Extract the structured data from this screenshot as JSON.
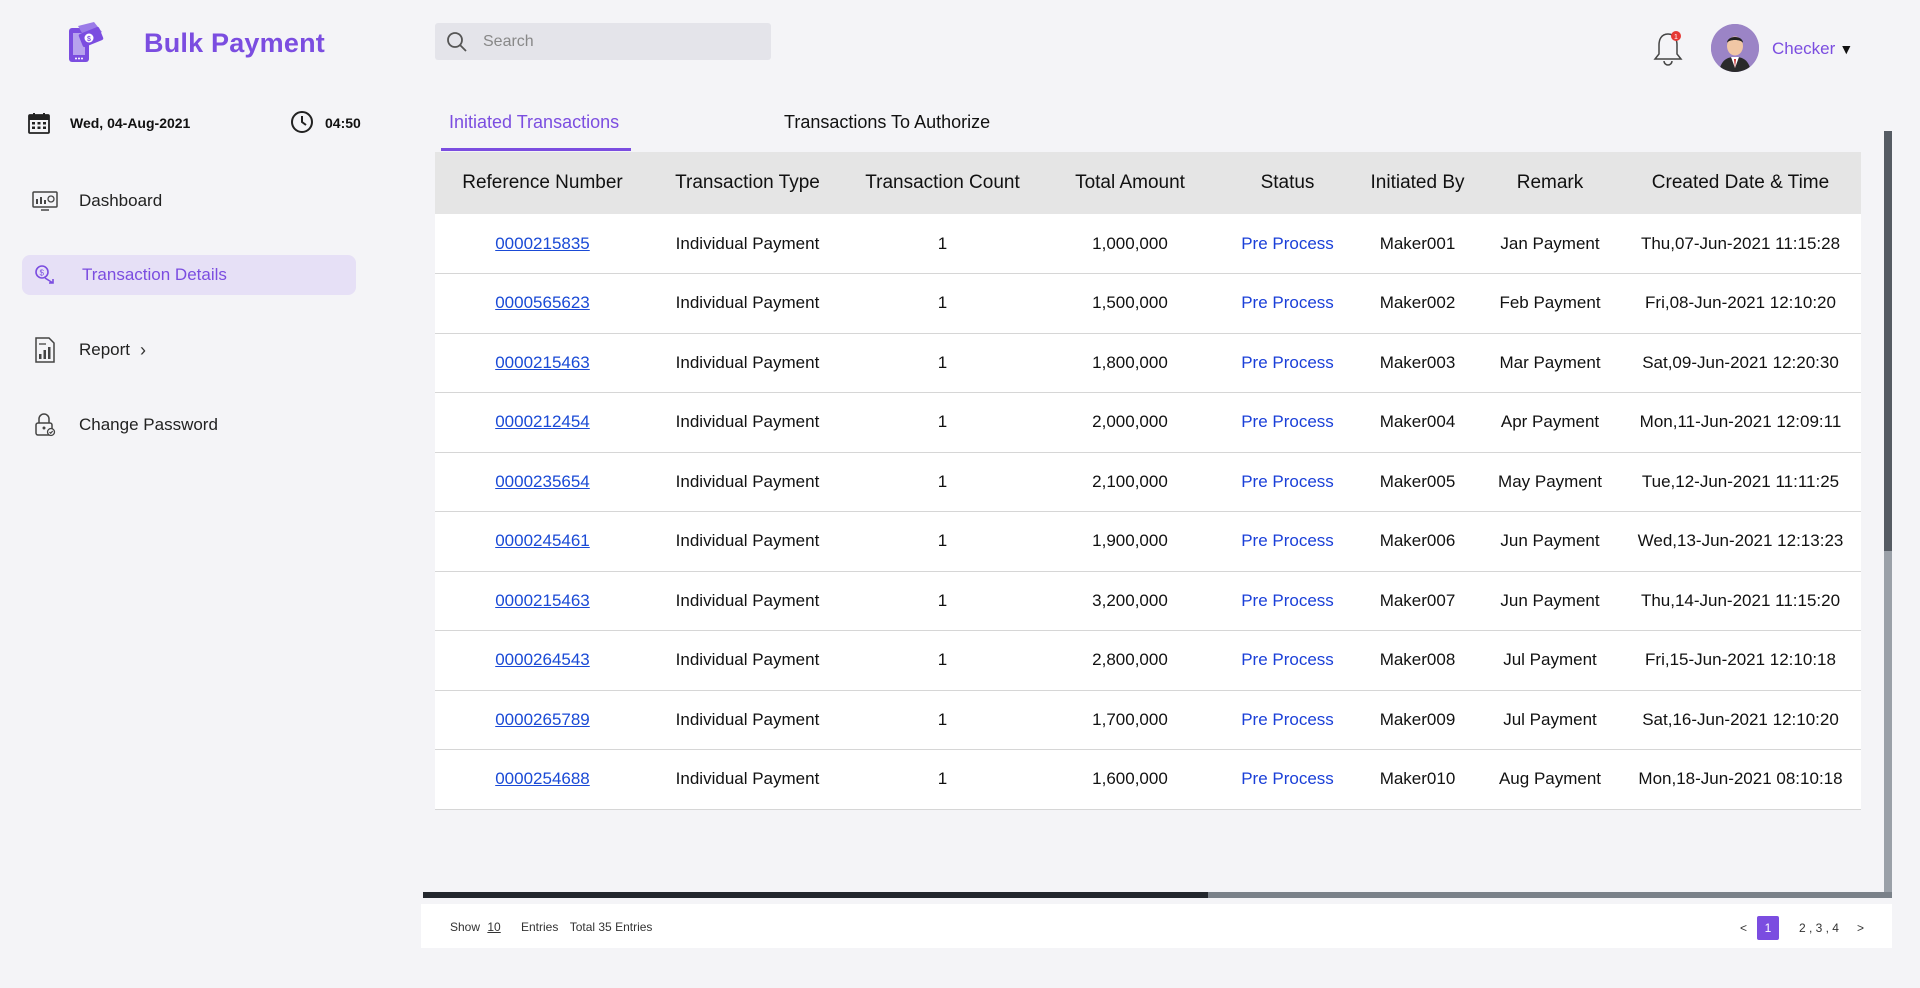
{
  "app": {
    "title": "Bulk Payment"
  },
  "datetime": {
    "date": "Wed, 04-Aug-2021",
    "time": "04:50"
  },
  "sidebar": {
    "items": [
      {
        "label": "Dashboard",
        "icon": "dashboard-icon",
        "active": false
      },
      {
        "label": "Transaction Details",
        "icon": "transaction-icon",
        "active": true
      },
      {
        "label": "Report",
        "icon": "report-icon",
        "active": false,
        "has_submenu": true
      },
      {
        "label": "Change Password",
        "icon": "lock-icon",
        "active": false
      }
    ]
  },
  "search": {
    "placeholder": "Search",
    "value": ""
  },
  "header": {
    "notification_count": "1",
    "user": "Checker"
  },
  "tabs": [
    {
      "label": "Initiated Transactions",
      "active": true
    },
    {
      "label": "Transactions To Authorize",
      "active": false
    }
  ],
  "table": {
    "columns": [
      "Reference Number",
      "Transaction Type",
      "Transaction Count",
      "Total Amount",
      "Status",
      "Initiated By",
      "Remark",
      "Created Date & Time"
    ],
    "rows": [
      {
        "ref": "0000215835",
        "type": "Individual Payment",
        "count": "1",
        "amount": "1,000,000",
        "status": "Pre Process",
        "by": "Maker001",
        "remark": "Jan Payment",
        "created": "Thu,07-Jun-2021  11:15:28"
      },
      {
        "ref": "0000565623",
        "type": "Individual Payment",
        "count": "1",
        "amount": "1,500,000",
        "status": "Pre Process",
        "by": "Maker002",
        "remark": "Feb Payment",
        "created": "Fri,08-Jun-2021  12:10:20"
      },
      {
        "ref": "0000215463",
        "type": "Individual Payment",
        "count": "1",
        "amount": "1,800,000",
        "status": "Pre Process",
        "by": "Maker003",
        "remark": "Mar Payment",
        "created": "Sat,09-Jun-2021  12:20:30"
      },
      {
        "ref": "0000212454",
        "type": "Individual Payment",
        "count": "1",
        "amount": "2,000,000",
        "status": "Pre Process",
        "by": "Maker004",
        "remark": "Apr Payment",
        "created": "Mon,11-Jun-2021 12:09:11"
      },
      {
        "ref": "0000235654",
        "type": "Individual Payment",
        "count": "1",
        "amount": "2,100,000",
        "status": "Pre Process",
        "by": "Maker005",
        "remark": "May Payment",
        "created": "Tue,12-Jun-2021  11:11:25"
      },
      {
        "ref": "0000245461",
        "type": "Individual Payment",
        "count": "1",
        "amount": "1,900,000",
        "status": "Pre Process",
        "by": "Maker006",
        "remark": "Jun Payment",
        "created": "Wed,13-Jun-2021 12:13:23"
      },
      {
        "ref": "0000215463",
        "type": "Individual Payment",
        "count": "1",
        "amount": "3,200,000",
        "status": "Pre Process",
        "by": "Maker007",
        "remark": "Jun Payment",
        "created": "Thu,14-Jun-2021  11:15:20"
      },
      {
        "ref": "0000264543",
        "type": "Individual Payment",
        "count": "1",
        "amount": "2,800,000",
        "status": "Pre Process",
        "by": "Maker008",
        "remark": "Jul Payment",
        "created": "Fri,15-Jun-2021  12:10:18"
      },
      {
        "ref": "0000265789",
        "type": "Individual Payment",
        "count": "1",
        "amount": "1,700,000",
        "status": "Pre Process",
        "by": "Maker009",
        "remark": "Jul Payment",
        "created": "Sat,16-Jun-2021  12:10:20"
      },
      {
        "ref": "0000254688",
        "type": "Individual Payment",
        "count": "1",
        "amount": "1,600,000",
        "status": "Pre Process",
        "by": "Maker010",
        "remark": "Aug Payment",
        "created": "Mon,18-Jun-2021 08:10:18"
      }
    ]
  },
  "footer": {
    "show_label": "Show",
    "show_value": "10",
    "entries_label": "Entries",
    "total_label": "Total 35 Entries",
    "pager": {
      "prev": "<",
      "current": "1",
      "pages": "2 , 3 ,  4",
      "next": ">"
    }
  },
  "colors": {
    "accent": "#7b4de0",
    "link": "#1a4ad6",
    "active_nav_bg": "#e6e0f6"
  }
}
